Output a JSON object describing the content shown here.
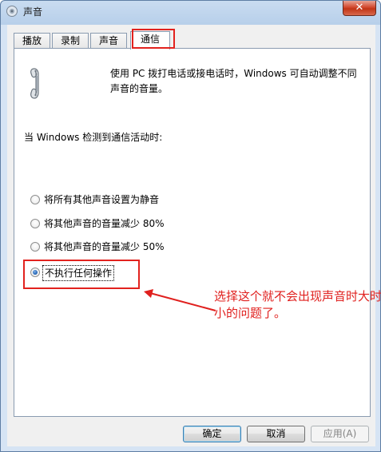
{
  "window": {
    "title": "声音",
    "close_glyph": "✕"
  },
  "tabs": [
    {
      "label": "播放"
    },
    {
      "label": "录制"
    },
    {
      "label": "声音"
    },
    {
      "label": "通信"
    }
  ],
  "communications": {
    "description": "使用 PC 拨打电话或接电话时，Windows 可自动调整不同声音的音量。",
    "question": "当 Windows 检测到通信活动时:",
    "options": [
      {
        "label": "将所有其他声音设置为静音",
        "checked": false
      },
      {
        "label": "将其他声音的音量减少 80%",
        "checked": false
      },
      {
        "label": "将其他声音的音量减少 50%",
        "checked": false
      },
      {
        "label": "不执行任何操作",
        "checked": true
      }
    ]
  },
  "annotation": {
    "text": "选择这个就不会出现声音时大时小的问题了。",
    "color": "#e0201e"
  },
  "buttons": {
    "ok": "确定",
    "cancel": "取消",
    "apply": "应用(A)"
  },
  "icons": {
    "title_icon": "speaker-icon",
    "phone_icon": "phone-handset-icon"
  }
}
